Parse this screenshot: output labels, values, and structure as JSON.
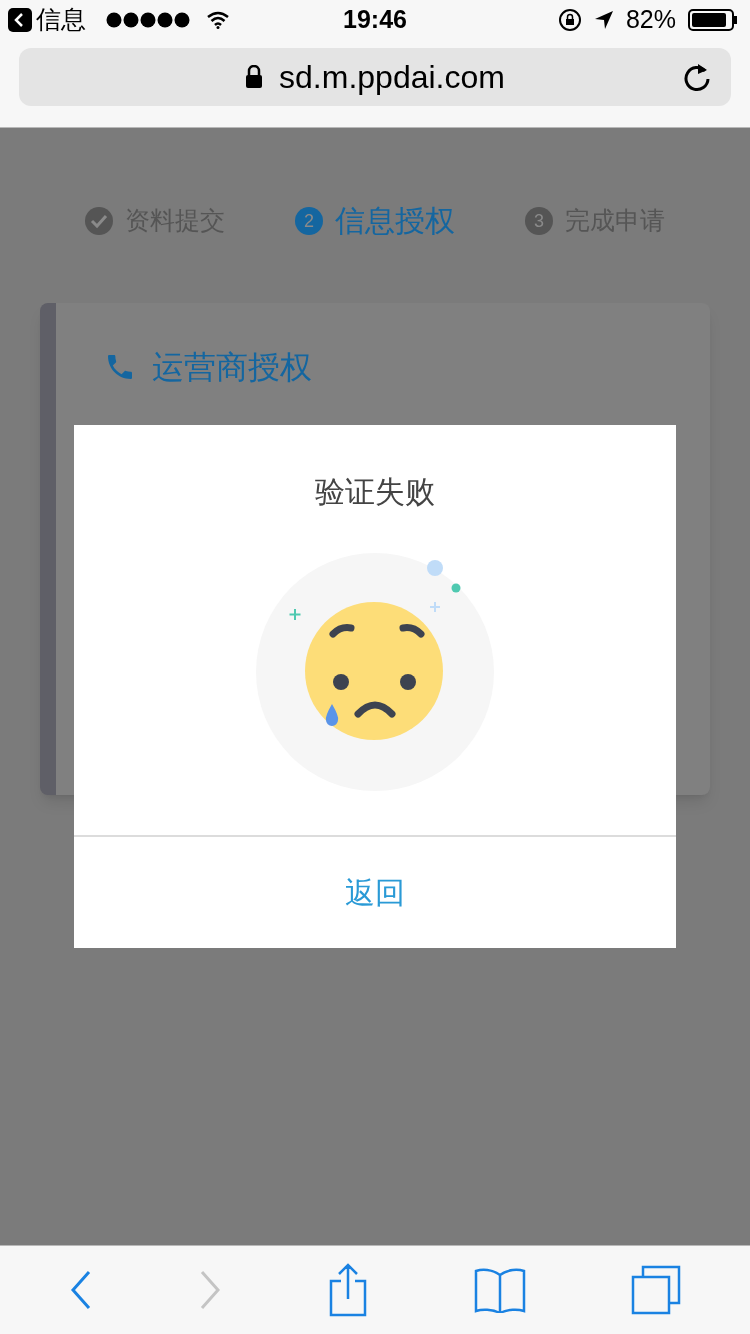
{
  "status_bar": {
    "back_app": "信息",
    "time": "19:46",
    "battery": "82%"
  },
  "address_bar": {
    "url": "sd.m.ppdai.com"
  },
  "steps": [
    {
      "kind": "done",
      "label": "资料提交",
      "selected": false
    },
    {
      "kind": "number",
      "number": "2",
      "label": "信息授权",
      "selected": true
    },
    {
      "kind": "number",
      "number": "3",
      "label": "完成申请",
      "selected": false
    }
  ],
  "card": {
    "title": "运营商授权"
  },
  "dialog": {
    "title": "验证失败",
    "button": "返回"
  },
  "toolbar": [
    {
      "kind": "back",
      "disabled": false
    },
    {
      "kind": "forward",
      "disabled": true
    },
    {
      "kind": "share",
      "disabled": false
    },
    {
      "kind": "bookmarks",
      "disabled": false
    },
    {
      "kind": "tabs",
      "disabled": false
    }
  ]
}
